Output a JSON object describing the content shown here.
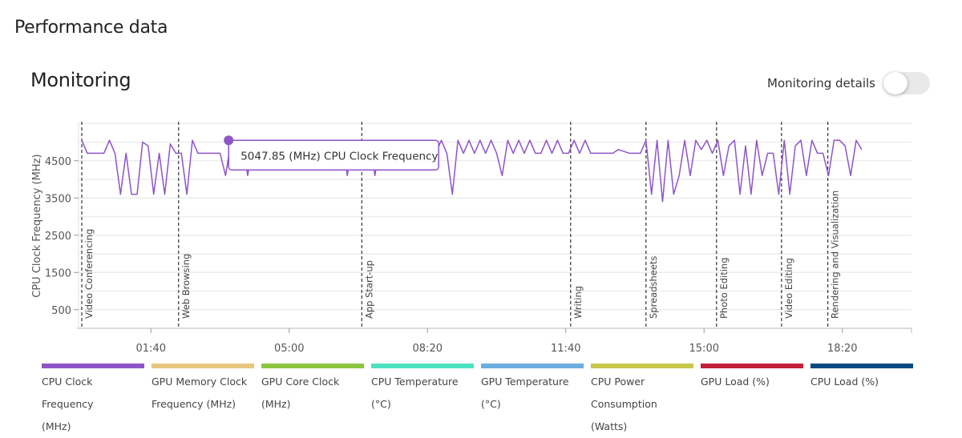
{
  "page_title": "Performance data",
  "section_title": "Monitoring",
  "toggle": {
    "label": "Monitoring details",
    "on": false
  },
  "tooltip": {
    "text": "5047.85 (MHz) CPU Clock Frequency",
    "t": 224,
    "value": 5047.85
  },
  "legend": [
    {
      "label_line1": "CPU Clock Frequency",
      "label_line2": "(MHz)",
      "color": "#8e55c8"
    },
    {
      "label_line1": "GPU Memory Clock",
      "label_line2": "Frequency (MHz)",
      "color": "#e6c77f"
    },
    {
      "label_line1": "GPU Core Clock (MHz)",
      "label_line2": "",
      "color": "#8cc63f"
    },
    {
      "label_line1": "CPU Temperature (°C)",
      "label_line2": "",
      "color": "#4ee3c0"
    },
    {
      "label_line1": "GPU Temperature (°C)",
      "label_line2": "",
      "color": "#6aaee0"
    },
    {
      "label_line1": "CPU Power",
      "label_line2": "Consumption (Watts)",
      "color": "#c9c64a"
    },
    {
      "label_line1": "GPU Load (%)",
      "label_line2": "",
      "color": "#c41e3a"
    },
    {
      "label_line1": "CPU Load (%)",
      "label_line2": "",
      "color": "#064a82"
    }
  ],
  "chart_data": {
    "type": "line",
    "ylabel": "CPU Clock Frequency (MHz)",
    "ylim": [
      0,
      5500
    ],
    "yticks": [
      500,
      1500,
      2500,
      3500,
      4500
    ],
    "xlim_seconds": [
      0,
      1200
    ],
    "xticks": [
      {
        "t": 100,
        "label": "01:40"
      },
      {
        "t": 300,
        "label": "05:00"
      },
      {
        "t": 500,
        "label": "08:20"
      },
      {
        "t": 700,
        "label": "11:40"
      },
      {
        "t": 900,
        "label": "15:00"
      },
      {
        "t": 1100,
        "label": "18:20"
      }
    ],
    "grid": true,
    "line_color": "#8e55c8",
    "phases": [
      {
        "t": 0,
        "label": "Video Conferencing"
      },
      {
        "t": 140,
        "label": "Web Browsing"
      },
      {
        "t": 405,
        "label": "App Start-up"
      },
      {
        "t": 707,
        "label": "Writing"
      },
      {
        "t": 816,
        "label": "Spreadsheets"
      },
      {
        "t": 918,
        "label": "Photo Editing"
      },
      {
        "t": 1012,
        "label": "Video Editing"
      },
      {
        "t": 1079,
        "label": "Rendering and Visualization"
      }
    ],
    "series": [
      {
        "name": "CPU Clock Frequency (MHz)",
        "t_step_seconds": 8,
        "values": [
          5050,
          4700,
          4700,
          4700,
          4700,
          5050,
          4700,
          3600,
          4700,
          3600,
          3600,
          5000,
          4900,
          3600,
          4700,
          3600,
          4950,
          4700,
          4700,
          3600,
          5050,
          4700,
          4700,
          4700,
          4700,
          4700,
          4100,
          5050,
          5048,
          5050,
          4100,
          5050,
          5050,
          5050,
          5050,
          5050,
          5050,
          5050,
          5050,
          5050,
          5050,
          5050,
          5050,
          5050,
          5050,
          5050,
          5050,
          5050,
          4100,
          5050,
          5050,
          5050,
          5050,
          4100,
          5050,
          5050,
          5050,
          5050,
          5050,
          5050,
          5050,
          5050,
          5050,
          5050,
          4700,
          5050,
          4700,
          3600,
          5050,
          4700,
          5050,
          4700,
          5050,
          4700,
          5050,
          4700,
          4100,
          5050,
          4700,
          5050,
          4700,
          5050,
          4700,
          4700,
          5050,
          4700,
          5050,
          4700,
          4700,
          5050,
          4700,
          5050,
          4700,
          4700,
          4700,
          4700,
          4700,
          4800,
          4750,
          4700,
          4700,
          4700,
          5050,
          3600,
          5050,
          3400,
          5050,
          3600,
          4100,
          5050,
          4100,
          5050,
          4800,
          5050,
          4700,
          5050,
          4100,
          4900,
          5050,
          3600,
          4900,
          3600,
          5050,
          4100,
          4700,
          4700,
          3600,
          5050,
          3600,
          4900,
          5050,
          4100,
          5050,
          4700,
          4700,
          4100,
          5050,
          5050,
          4900,
          4100,
          5050,
          4800
        ]
      }
    ]
  }
}
